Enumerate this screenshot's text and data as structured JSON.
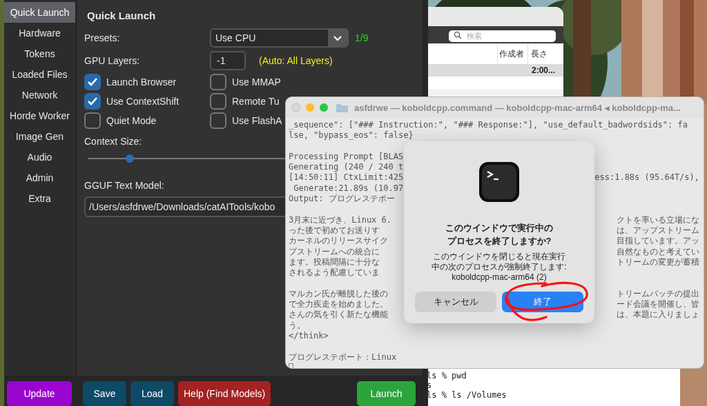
{
  "kobold": {
    "tabs": [
      {
        "label": "Quick Launch",
        "selected": true
      },
      {
        "label": "Hardware",
        "selected": false
      },
      {
        "label": "Tokens",
        "selected": false
      },
      {
        "label": "Loaded Files",
        "selected": false
      },
      {
        "label": "Network",
        "selected": false
      },
      {
        "label": "Horde Worker",
        "selected": false
      },
      {
        "label": "Image Gen",
        "selected": false
      },
      {
        "label": "Audio",
        "selected": false
      },
      {
        "label": "Admin",
        "selected": false
      },
      {
        "label": "Extra",
        "selected": false
      }
    ],
    "heading": "Quick Launch",
    "presets": {
      "label": "Presets:",
      "value": "Use CPU",
      "count": "1/9"
    },
    "gpu_layers": {
      "label": "GPU Layers:",
      "value": "-1",
      "note": "(Auto: All Layers)"
    },
    "options": [
      {
        "label": "Launch Browser",
        "checked": true
      },
      {
        "label": "Use MMAP",
        "checked": false
      },
      {
        "label": "Use ContextShift",
        "checked": true
      },
      {
        "label": "Remote Tu",
        "checked": false
      },
      {
        "label": "Quiet Mode",
        "checked": false
      },
      {
        "label": "Use FlashA",
        "checked": false
      }
    ],
    "context_size": {
      "label": "Context Size:",
      "level": 0.13
    },
    "model": {
      "label": "GGUF Text Model:",
      "value": "/Users/asfdrwe/Downloads/catAITools/kobo"
    },
    "buttons": [
      {
        "label": "Update",
        "color": "#9a05cf"
      },
      {
        "label": "Save",
        "color": "#0d4a68"
      },
      {
        "label": "Load",
        "color": "#0d4a68"
      },
      {
        "label": "Help (Find Models)",
        "color": "#a32222"
      }
    ],
    "launch_button": {
      "label": "Launch",
      "color": "#2ba43c"
    }
  },
  "music_window": {
    "search": {
      "placeholder": "検索"
    },
    "columns": [
      "作成者",
      "長さ"
    ],
    "rows": [
      {
        "length": "2:00...",
        "selected": true
      }
    ]
  },
  "back_terminal": {
    "lines": [
      "ls % pwd",
      "s",
      "ls % ls /Volumes"
    ]
  },
  "terminal": {
    "title": "asfdrwe — koboldcpp.command — koboldcpp-mac-arm64 ◂ koboldcpp-ma...",
    "lines": [
      {
        "kind": "text",
        "left": "_sequence\": [\"### Instruction:\", \"### Response:\"], \"use_default_badwordsids\": fa"
      },
      {
        "kind": "text",
        "left": "lse, \"bypass_eos\": false}"
      },
      {
        "kind": "blank"
      },
      {
        "kind": "text",
        "left": "Processing Prompt [BLAS"
      },
      {
        "kind": "text",
        "left": "Generating (240 / 240 t"
      },
      {
        "kind": "text",
        "left": "[14:50:11] CtxLimit:425",
        "right": "ess:1.88s (95.64T/s),"
      },
      {
        "kind": "text",
        "left": " Generate:21.89s (10.97"
      },
      {
        "kind": "text",
        "left": "Output: プログレステポー"
      },
      {
        "kind": "blank"
      },
      {
        "kind": "text",
        "left": "3月末に近づき、Linux 6.",
        "right": "クトを率いる立場にな"
      },
      {
        "kind": "text",
        "left": "った後で初めてお送りす",
        "right": "は、アップストリーム"
      },
      {
        "kind": "text",
        "left": "カーネルのリリースサイク",
        "right": "目指しています。アッ"
      },
      {
        "kind": "text",
        "left": "プストリームへの統合に",
        "right": "自然なものと考えてい"
      },
      {
        "kind": "text",
        "left": "ます。投稿間隔に十分な",
        "right": "トリームの変更が蓄積"
      },
      {
        "kind": "text",
        "left": "されるよう配慮していま"
      },
      {
        "kind": "blank"
      },
      {
        "kind": "text",
        "left": "マルカン氏が離脱した後の",
        "right": "トリームパッチの提出"
      },
      {
        "kind": "text",
        "left": "で全力疾走を始めました。",
        "right": "ード会議を開催し、皆"
      },
      {
        "kind": "text",
        "left": "さんの気を引く新たな機能",
        "right": "は、本題に入りましょ"
      },
      {
        "kind": "text",
        "left": "う。"
      },
      {
        "kind": "text",
        "left": "</think>"
      },
      {
        "kind": "blank"
      },
      {
        "kind": "text",
        "left": "プログレステポート：Linux"
      },
      {
        "kind": "cursor"
      }
    ]
  },
  "dialog": {
    "title_lines": [
      "このウインドウで実行中の",
      "プロセスを終了しますか?"
    ],
    "message_lines": [
      "このウインドウを閉じると現在実行",
      "中の次のプロセスが強制終了します:",
      "koboldcpp-mac-arm64 (2)"
    ],
    "buttons": [
      {
        "label": "キャンセル",
        "kind": "cancel"
      },
      {
        "label": "終了",
        "kind": "default"
      }
    ]
  }
}
